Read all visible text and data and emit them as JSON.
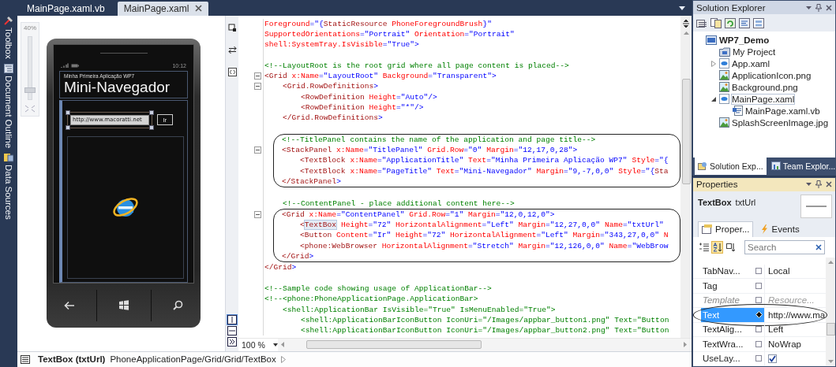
{
  "side_dock": [
    {
      "label": "Toolbox",
      "kind": "toolbox"
    },
    {
      "label": "Document Outline",
      "kind": "outline"
    },
    {
      "label": "Data Sources",
      "kind": "data"
    }
  ],
  "document_tabs": [
    {
      "label": "MainPage.xaml.vb",
      "selected": false
    },
    {
      "label": "MainPage.xaml",
      "selected": true
    }
  ],
  "designer": {
    "zoom_label": "40%",
    "zoom_slider": {
      "level": 0.1
    },
    "phone": {
      "time": "10:12",
      "app_title": "Minha Primeira Aplicação WP7",
      "page_title": "Mini-Navegador",
      "url_value": "http://www.macoratti.net",
      "go_button": "Ir"
    }
  },
  "editor": {
    "zoom": "100 %",
    "blocks": [
      {
        "circled": false,
        "lines": [
          {
            "fold": false,
            "tokens": [
              {
                "kind": "attr",
                "text": "Foreground"
              },
              {
                "kind": "value",
                "text": "=\"{"
              },
              {
                "kind": "tag",
                "text": "StaticResource"
              },
              {
                "kind": "attr",
                "text": " PhoneForegroundBrush"
              },
              {
                "kind": "value",
                "text": "}\""
              }
            ]
          },
          {
            "fold": false,
            "tokens": [
              {
                "kind": "attr",
                "text": "SupportedOrientations"
              },
              {
                "kind": "value",
                "text": "=\"Portrait\""
              },
              {
                "kind": "attr",
                "text": " Orientation"
              },
              {
                "kind": "value",
                "text": "=\"Portrait\""
              }
            ]
          },
          {
            "fold": false,
            "tokens": [
              {
                "kind": "attr",
                "text": "shell:SystemTray.IsVisible"
              },
              {
                "kind": "value",
                "text": "=\"True\">"
              }
            ]
          },
          {
            "fold": false
          },
          {
            "fold": false,
            "tokens": [
              {
                "kind": "comment",
                "text": "<!--LayoutRoot is the root grid where all page content is placed-->"
              }
            ]
          },
          {
            "fold": true,
            "tokens": [
              {
                "kind": "tag",
                "text": "<Grid"
              },
              {
                "kind": "attr",
                "text": " x:Name"
              },
              {
                "kind": "value",
                "text": "=\"LayoutRoot\""
              },
              {
                "kind": "attr",
                "text": " Background"
              },
              {
                "kind": "value",
                "text": "=\"Transparent\">"
              }
            ]
          },
          {
            "fold": true,
            "tokens": [
              {
                "kind": "tag",
                "text": "    <Grid.RowDefinitions"
              },
              {
                "kind": "value",
                "text": ">"
              }
            ]
          },
          {
            "fold": false,
            "tokens": [
              {
                "kind": "tag",
                "text": "        <RowDefinition"
              },
              {
                "kind": "attr",
                "text": " Height"
              },
              {
                "kind": "value",
                "text": "=\"Auto\"/>"
              }
            ]
          },
          {
            "fold": false,
            "tokens": [
              {
                "kind": "tag",
                "text": "        <RowDefinition"
              },
              {
                "kind": "attr",
                "text": " Height"
              },
              {
                "kind": "value",
                "text": "=\"*\"/>"
              }
            ]
          },
          {
            "fold": false,
            "tokens": [
              {
                "kind": "tag",
                "text": "    </Grid.RowDefinitions"
              },
              {
                "kind": "value",
                "text": ">"
              }
            ]
          },
          {
            "fold": false
          }
        ]
      },
      {
        "circled": true,
        "lines": [
          {
            "fold": false,
            "tokens": [
              {
                "kind": "comment",
                "text": "    <!--TitlePanel contains the name of the application and page title-->"
              }
            ]
          },
          {
            "fold": true,
            "tokens": [
              {
                "kind": "tag",
                "text": "    <StackPanel"
              },
              {
                "kind": "attr",
                "text": " x:Name"
              },
              {
                "kind": "value",
                "text": "=\"TitlePanel\""
              },
              {
                "kind": "attr",
                "text": " Grid.Row"
              },
              {
                "kind": "value",
                "text": "=\"0\""
              },
              {
                "kind": "attr",
                "text": " Margin"
              },
              {
                "kind": "value",
                "text": "=\"12,17,0,28\">"
              }
            ]
          },
          {
            "fold": false,
            "tokens": [
              {
                "kind": "tag",
                "text": "        <TextBlock"
              },
              {
                "kind": "attr",
                "text": " x:Name"
              },
              {
                "kind": "value",
                "text": "=\"ApplicationTitle\""
              },
              {
                "kind": "attr",
                "text": " Text"
              },
              {
                "kind": "value",
                "text": "=\"Minha Primeira Aplicação WP7\""
              },
              {
                "kind": "attr",
                "text": " Style"
              },
              {
                "kind": "value",
                "text": "=\"{"
              }
            ]
          },
          {
            "fold": false,
            "tokens": [
              {
                "kind": "tag",
                "text": "        <TextBlock"
              },
              {
                "kind": "attr",
                "text": " x:Name"
              },
              {
                "kind": "value",
                "text": "=\"PageTitle\""
              },
              {
                "kind": "attr",
                "text": " Text"
              },
              {
                "kind": "value",
                "text": "=\"Mini-Navegador\""
              },
              {
                "kind": "attr",
                "text": " Margin"
              },
              {
                "kind": "value",
                "text": "=\"9,-7,0,0\""
              },
              {
                "kind": "attr",
                "text": " Style"
              },
              {
                "kind": "value",
                "text": "=\"{"
              },
              {
                "kind": "tag",
                "text": "Sta"
              }
            ]
          },
          {
            "fold": false,
            "tokens": [
              {
                "kind": "tag",
                "text": "    </StackPanel"
              },
              {
                "kind": "value",
                "text": ">"
              }
            ]
          }
        ]
      },
      {
        "circled": false,
        "lines": [
          {
            "fold": false
          },
          {
            "fold": false,
            "tokens": [
              {
                "kind": "comment",
                "text": "    <!--ContentPanel - place additional content here-->"
              }
            ]
          }
        ]
      },
      {
        "circled": true,
        "lines": [
          {
            "fold": true,
            "tokens": [
              {
                "kind": "tag",
                "text": "    <Grid"
              },
              {
                "kind": "attr",
                "text": " x:Name"
              },
              {
                "kind": "value",
                "text": "=\"ContentPanel\""
              },
              {
                "kind": "attr",
                "text": " Grid.Row"
              },
              {
                "kind": "value",
                "text": "=\"1\""
              },
              {
                "kind": "attr",
                "text": " Margin"
              },
              {
                "kind": "value",
                "text": "=\"12,0,12,0\">"
              }
            ]
          },
          {
            "fold": false,
            "tokens": [
              {
                "kind": "tag",
                "text": "        <"
              },
              {
                "kind": "tag_marked",
                "text": "TextBox"
              },
              {
                "kind": "attr",
                "text": " Height"
              },
              {
                "kind": "value",
                "text": "=\"72\""
              },
              {
                "kind": "attr",
                "text": " HorizontalAlignment"
              },
              {
                "kind": "value",
                "text": "=\"Left\""
              },
              {
                "kind": "attr",
                "text": " Margin"
              },
              {
                "kind": "value",
                "text": "=\"12,27,0,0\""
              },
              {
                "kind": "attr",
                "text": " Name"
              },
              {
                "kind": "value",
                "text": "=\"txtUrl\""
              }
            ]
          },
          {
            "fold": false,
            "tokens": [
              {
                "kind": "tag",
                "text": "        <Button"
              },
              {
                "kind": "attr",
                "text": " Content"
              },
              {
                "kind": "value",
                "text": "=\"Ir\""
              },
              {
                "kind": "attr",
                "text": " Height"
              },
              {
                "kind": "value",
                "text": "=\"72\""
              },
              {
                "kind": "attr",
                "text": " HorizontalAlignment"
              },
              {
                "kind": "value",
                "text": "=\"Left\""
              },
              {
                "kind": "attr",
                "text": " Margin"
              },
              {
                "kind": "value",
                "text": "=\"343,27,0,0\""
              },
              {
                "kind": "attr",
                "text": " N"
              }
            ]
          },
          {
            "fold": false,
            "tokens": [
              {
                "kind": "tag",
                "text": "        <phone:WebBrowser"
              },
              {
                "kind": "attr",
                "text": " HorizontalAlignment"
              },
              {
                "kind": "value",
                "text": "=\"Stretch\""
              },
              {
                "kind": "attr",
                "text": " Margin"
              },
              {
                "kind": "value",
                "text": "=\"12,126,0,0\""
              },
              {
                "kind": "attr",
                "text": " Name"
              },
              {
                "kind": "value",
                "text": "=\"WebBrow"
              }
            ]
          },
          {
            "fold": false,
            "tokens": [
              {
                "kind": "tag",
                "text": "    </Grid"
              },
              {
                "kind": "value",
                "text": ">"
              }
            ]
          }
        ]
      },
      {
        "circled": false,
        "lines": [
          {
            "fold": false,
            "tokens": [
              {
                "kind": "tag",
                "text": "</Grid"
              },
              {
                "kind": "value",
                "text": ">"
              }
            ]
          },
          {
            "fold": false
          },
          {
            "fold": false,
            "tokens": [
              {
                "kind": "comment",
                "text": "<!--Sample code showing usage of ApplicationBar-->"
              }
            ]
          },
          {
            "fold": false,
            "tokens": [
              {
                "kind": "comment",
                "text": "<!--<phone:PhoneApplicationPage.ApplicationBar>"
              }
            ]
          },
          {
            "fold": false,
            "tokens": [
              {
                "kind": "comment",
                "text": "    <shell:ApplicationBar IsVisible=\"True\" IsMenuEnabled=\"True\">"
              }
            ]
          },
          {
            "fold": false,
            "tokens": [
              {
                "kind": "comment",
                "text": "        <shell:ApplicationBarIconButton IconUri=\"/Images/appbar_button1.png\" Text=\"Button"
              }
            ]
          },
          {
            "fold": false,
            "tokens": [
              {
                "kind": "comment",
                "text": "        <shell:ApplicationBarIconButton IconUri=\"/Images/appbar_button2.png\" Text=\"Button"
              }
            ]
          }
        ]
      }
    ]
  },
  "status_bar": {
    "element": "TextBox (txtUrl)",
    "path": "PhoneApplicationPage/Grid/Grid/TextBox"
  },
  "solution_explorer": {
    "title": "Solution Explorer",
    "tree": [
      {
        "label": "WP7_Demo",
        "kind": "project",
        "selected": false,
        "children": [
          {
            "label": "My Project",
            "kind": "properties",
            "selected": false
          },
          {
            "label": "App.xaml",
            "kind": "xaml",
            "expanded": false,
            "selected": false
          },
          {
            "label": "ApplicationIcon.png",
            "kind": "image",
            "selected": false
          },
          {
            "label": "Background.png",
            "kind": "image",
            "selected": false
          },
          {
            "label": "MainPage.xaml",
            "kind": "xaml",
            "expanded": true,
            "selected": true,
            "children": [
              {
                "label": "MainPage.xaml.vb",
                "kind": "code",
                "selected": false
              }
            ]
          },
          {
            "label": "SplashScreenImage.jpg",
            "kind": "image",
            "selected": false
          }
        ]
      }
    ],
    "tabs": [
      {
        "label": "Solution Exp...",
        "kind": "solution",
        "selected": true
      },
      {
        "label": "Team Explor...",
        "kind": "team",
        "selected": false
      }
    ]
  },
  "properties": {
    "title": "Properties",
    "object_type": "TextBox",
    "object_name": "txtUrl",
    "tabs": [
      {
        "label": "Proper...",
        "kind": "properties",
        "selected": true
      },
      {
        "label": "Events",
        "kind": "events",
        "selected": false
      }
    ],
    "view_buttons": [
      {
        "kind": "categorized",
        "selected": false
      },
      {
        "kind": "alphabetical",
        "selected": true
      },
      {
        "kind": "events",
        "selected": false
      }
    ],
    "search": {
      "placeholder": "Search"
    },
    "rows": [
      {
        "name": "TabNav...",
        "kind": "text",
        "value": "Local",
        "set": false,
        "selected": false,
        "dimmed": false,
        "circled": false
      },
      {
        "name": "Tag",
        "kind": "text",
        "set": false,
        "selected": false,
        "dimmed": false,
        "circled": false
      },
      {
        "name": "Template",
        "kind": "text",
        "value": "Resource...",
        "set": false,
        "selected": false,
        "dimmed": true,
        "circled": false
      },
      {
        "name": "Text",
        "kind": "text",
        "value": "http://www.ma",
        "set": true,
        "selected": true,
        "dimmed": false,
        "circled": true
      },
      {
        "name": "TextAlig...",
        "kind": "text",
        "value": "Left",
        "set": false,
        "selected": false,
        "dimmed": false,
        "circled": false
      },
      {
        "name": "TextWra...",
        "kind": "text",
        "value": "NoWrap",
        "set": false,
        "selected": false,
        "dimmed": false,
        "circled": false
      },
      {
        "name": "UseLay...",
        "kind": "checkbox",
        "checked": true,
        "set": false,
        "selected": false,
        "dimmed": false,
        "circled": false
      }
    ]
  }
}
